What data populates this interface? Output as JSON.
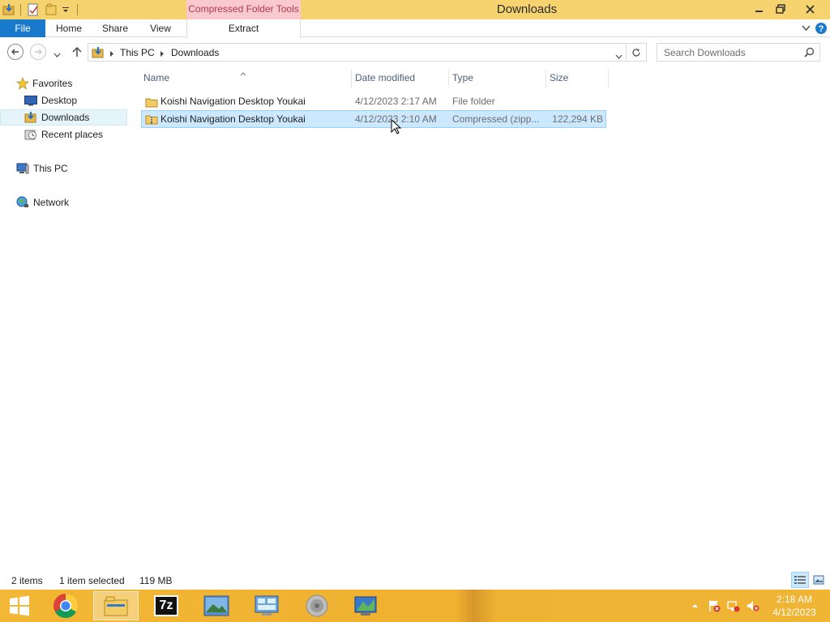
{
  "window": {
    "title": "Downloads",
    "context_tab_header": "Compressed Folder Tools"
  },
  "ribbon": {
    "file_tab": "File",
    "tabs": [
      "Home",
      "Share",
      "View"
    ],
    "context_tab": "Extract"
  },
  "address": {
    "crumbs": [
      "This PC",
      "Downloads"
    ],
    "search_placeholder": "Search Downloads"
  },
  "nav": {
    "favorites": "Favorites",
    "items": [
      "Desktop",
      "Downloads",
      "Recent places"
    ],
    "this_pc": "This PC",
    "network": "Network"
  },
  "columns": [
    "Name",
    "Date modified",
    "Type",
    "Size"
  ],
  "files": [
    {
      "name": "Koishi Navigation Desktop Youkai",
      "date": "4/12/2023 2:17 AM",
      "type": "File folder",
      "size": "",
      "icon": "folder-icon"
    },
    {
      "name": "Koishi Navigation Desktop Youkai",
      "date": "4/12/2023 2:10 AM",
      "type": "Compressed (zipp...",
      "size": "122,294 KB",
      "icon": "zip-folder-icon"
    }
  ],
  "status": {
    "count": "2 items",
    "selection": "1 item selected",
    "size": "119 MB"
  },
  "taskbar": {
    "time": "2:18 AM",
    "date": "4/12/2023",
    "apps": [
      "chrome-icon",
      "file-explorer-icon",
      "7zip-icon",
      "photo-viewer-icon",
      "control-panel-icon",
      "speaker-icon",
      "network-app-icon"
    ],
    "seven_zip_label": "7z"
  },
  "colors": {
    "titlebar": "#f6d36e",
    "file_tab": "#1979ca",
    "selection": "#cce8ff",
    "taskbar": "#f2b735"
  }
}
